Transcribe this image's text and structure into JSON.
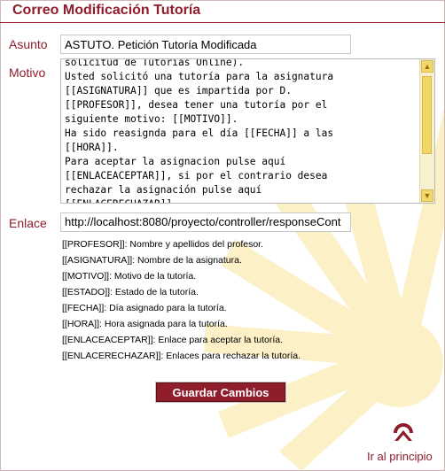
{
  "header": {
    "title": "Correo Modificación Tutoría"
  },
  "form": {
    "subject_label": "Asunto",
    "subject_value": "ASTUTO. Petición Tutoría Modificada",
    "reason_label": "Motivo",
    "message_text": "solicitud de Tutorías Online).\nUsted solicitó una tutoría para la asignatura\n[[ASIGNATURA]] que es impartida por D.\n[[PROFESOR]], desea tener una tutoría por el\nsiguiente motivo: [[MOTIVO]].\nHa sido reasignda para el día [[FECHA]] a las\n[[HORA]].\nPara aceptar la asignacion pulse aquí\n[[ENLACEACEPTAR]], si por el contrario desea\nrechazar la asignación pulse aquí\n[[ENLACERECHAZAR]]",
    "link_label": "Enlace",
    "link_value": "http://localhost:8080/proyecto/controller/responseCont"
  },
  "help": {
    "lines": [
      "[[PROFESOR]]: Nombre y apellidos del profesor.",
      "[[ASIGNATURA]]: Nombre de la asignatura.",
      "[[MOTIVO]]: Motivo de la tutoría.",
      "[[ESTADO]]: Estado de la tutoría.",
      "[[FECHA]]: Día asignado para la tutoría.",
      "[[HORA]]: Hora asignada para la tutoría.",
      "[[ENLACEACEPTAR]]: Enlace para aceptar la tutoría.",
      "[[ENLACERECHAZAR]]: Enlaces para rechazar la tutoría."
    ]
  },
  "actions": {
    "save_label": "Guardar Cambios",
    "top_link_label": "Ir al principio",
    "top_icon": "up-arrow-icon"
  },
  "colors": {
    "accent": "#8f1d2c",
    "background_motif": "#fbe8a6",
    "scrollbar": "#f1d766"
  }
}
